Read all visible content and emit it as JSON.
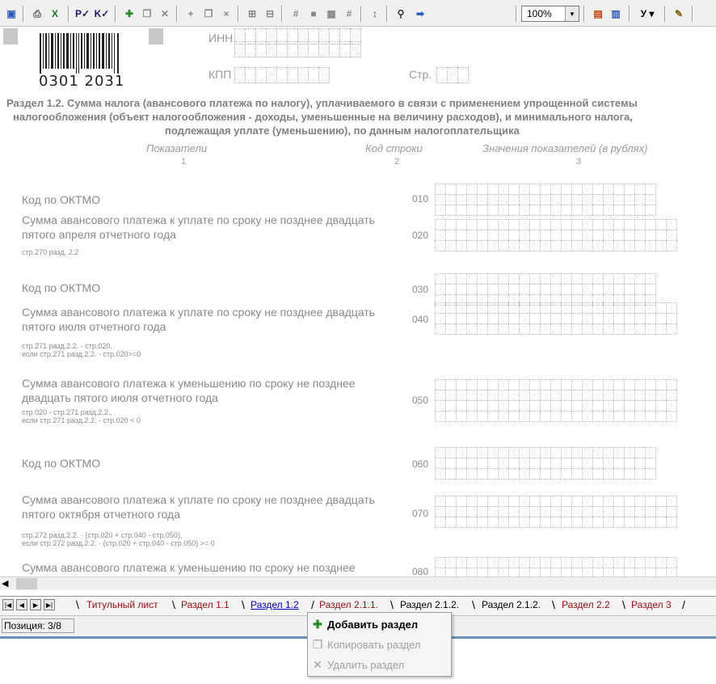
{
  "toolbar": {
    "buttons": [
      "save-icon",
      "print-icon",
      "excel-icon",
      "check-p-icon",
      "check-k-icon",
      "add-section-icon",
      "copy-section-icon",
      "delete-section-icon",
      "insert-row-icon",
      "copy-row-icon",
      "delete-row-icon",
      "insert-col-icon",
      "delete-col-icon",
      "format-icon",
      "fill-icon",
      "fill2-icon",
      "format2-icon",
      "sort-icon",
      "find-icon",
      "goto-icon"
    ],
    "zoom": "100%",
    "u_label": "У"
  },
  "form": {
    "barcode": "0301 2031",
    "inn_label": "ИНН",
    "kpp_label": "КПП",
    "page_label": "Стр.",
    "title_line1": "Раздел 1.2. Сумма налога (авансового платежа по налогу), уплачиваемого в связи с применением упрощенной системы",
    "title_line2": "налогообложения (объект налогообложения - доходы, уменьшенные на величину расходов), и минимального налога,",
    "title_line3": "подлежащая уплате (уменьшению), по данным налогоплательщика",
    "col1": "Показатели",
    "col2": "Код строки",
    "col3": "Значения показателей (в рублях)",
    "num1": "1",
    "num2": "2",
    "num3": "3"
  },
  "rows": [
    {
      "label": "Код по ОКТМО",
      "code": "010",
      "sub": ""
    },
    {
      "label": "Сумма авансового платежа к уплате по сроку не позднее двадцать пятого апреля отчетного года",
      "code": "020",
      "sub": "стр.270 разд. 2.2"
    },
    {
      "label": "Код по ОКТМО",
      "code": "030",
      "sub": ""
    },
    {
      "label": "Сумма  авансового платежа к уплате по сроку не позднее двадцать пятого июля отчетного года",
      "code": "040",
      "sub": "стр.271 разд.2.2. - стр.020,\nесли стр.271 разд.2.2. - стр.020>=0"
    },
    {
      "label": "Сумма авансового платежа к уменьшению по сроку не позднее двадцать пятого июля отчетного года",
      "code": "050",
      "sub": "стр.020 - стр.271 разд.2.2.,\nесли стр.271 разд.2.2. - стр.020 < 0"
    },
    {
      "label": "Код по ОКТМО",
      "code": "060",
      "sub": ""
    },
    {
      "label": "Сумма авансового платежа к уплате по сроку не позднее двадцать пятого октября отчетного года",
      "code": "070",
      "sub": "стр.272 разд.2.2. - (стр.020 + стр.040 - стр.050),\nесли стр.272 разд.2.2. - (стр.020 + стр.040 - стр.050) >= 0"
    },
    {
      "label": "Сумма авансового платежа к уменьшению по сроку не позднее",
      "code": "080",
      "sub": ""
    }
  ],
  "tabs": [
    {
      "label": "Титульный лист"
    },
    {
      "label": "Раздел 1.1"
    },
    {
      "label": "Раздел 1.2"
    },
    {
      "label": "Раздел 2.1.1."
    },
    {
      "label": "Раздел 2.1.2."
    },
    {
      "label": "Раздел 2.1.2."
    },
    {
      "label": "Раздел 2.2"
    },
    {
      "label": "Раздел 3"
    }
  ],
  "status": {
    "position": "Позиция: 3/8"
  },
  "context_menu": {
    "add": "Добавить раздел",
    "copy": "Копировать раздел",
    "delete": "Удалить раздел"
  }
}
